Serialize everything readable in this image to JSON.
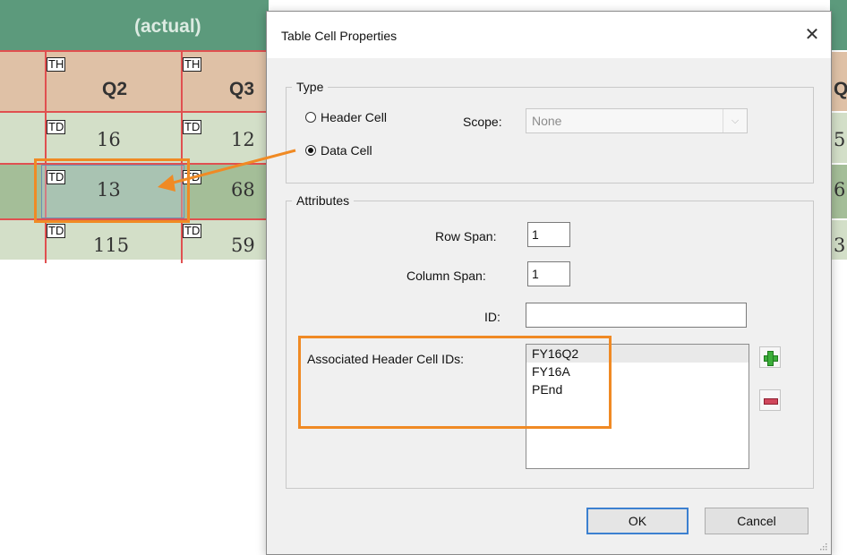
{
  "background_table": {
    "header_label": "(actual)",
    "th_tag": "TH",
    "td_tag": "TD",
    "col_headers": [
      "Q2",
      "Q3"
    ],
    "rows": [
      [
        "16",
        "12"
      ],
      [
        "13",
        "68"
      ],
      [
        "115",
        "59"
      ]
    ],
    "sliver_header": "Q",
    "sliver_values": [
      "5",
      "6",
      "3"
    ],
    "colors": {
      "header_band": "#5c9a7c",
      "th_row": "#dfc1a6",
      "data_row": "#d3dfc8",
      "data_row_alt": "#a4be98",
      "cell_border": "#e05050",
      "highlight": "#f08a24"
    }
  },
  "dialog": {
    "title": "Table Cell Properties",
    "close_symbol": "✕",
    "type_group": {
      "legend": "Type",
      "header_cell_label": "Header Cell",
      "data_cell_label": "Data Cell",
      "selected": "Data Cell",
      "scope_label": "Scope:",
      "scope_value": "None"
    },
    "attributes_group": {
      "legend": "Attributes",
      "row_span_label": "Row Span:",
      "row_span_value": "1",
      "column_span_label": "Column Span:",
      "column_span_value": "1",
      "id_label": "ID:",
      "id_value": "",
      "associated_label": "Associated Header Cell IDs:",
      "associated_ids": [
        "FY16Q2",
        "FY16A",
        "PEnd"
      ],
      "selected_id": "FY16Q2",
      "add_icon": "plus-icon",
      "remove_icon": "minus-icon"
    },
    "buttons": {
      "ok": "OK",
      "cancel": "Cancel"
    }
  }
}
